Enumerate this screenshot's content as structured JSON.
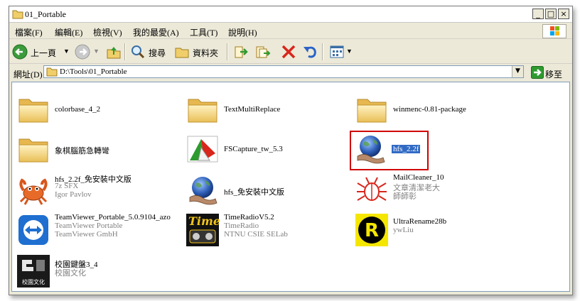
{
  "window": {
    "title": "01_Portable"
  },
  "menu": [
    "檔案(F)",
    "編輯(E)",
    "檢視(V)",
    "我的最愛(A)",
    "工具(T)",
    "說明(H)"
  ],
  "toolbar": {
    "back_label": "上一頁",
    "search_label": "搜尋",
    "folders_label": "資料夾"
  },
  "address": {
    "label": "網址(D)",
    "path": "D:\\Tools\\01_Portable",
    "go_label": "移至"
  },
  "items": [
    {
      "name": "colorbase_4_2"
    },
    {
      "name": "TextMultiReplace"
    },
    {
      "name": "winmenc-0.81-package"
    },
    {
      "name": "象棋腦筋急轉彎"
    },
    {
      "name": "FSCapture_tw_5.3"
    },
    {
      "name": "hfs_2.2f"
    },
    {
      "name": "hfs_2.2f_免安裝中文版",
      "sub1": "7z SFX",
      "sub2": "Igor Pavlov"
    },
    {
      "name": "hfs_免安裝中文版"
    },
    {
      "name": "MailCleaner_10",
      "sub1": "文章清潔老大",
      "sub2": "師師彰"
    },
    {
      "name": "TeamViewer_Portable_5.0.9104_azo",
      "sub1": "TeamViewer Portable",
      "sub2": "TeamViewer GmbH"
    },
    {
      "name": "TimeRadioV5.2",
      "sub1": "TimeRadio",
      "sub2": "NTNU CSIE SELab"
    },
    {
      "name": "UltraRename28b",
      "sub1": "ywLiu"
    },
    {
      "name": "校園鍵盤3_4",
      "sub1": "校園文化"
    }
  ],
  "icon_text": {
    "timeradio_logo": "Time",
    "ultrarename_logo": "R",
    "school_logo": "校園文化"
  },
  "colors": {
    "selection": "#316ac5",
    "highlight_box": "#d00000",
    "folder": "#f3d27a"
  }
}
